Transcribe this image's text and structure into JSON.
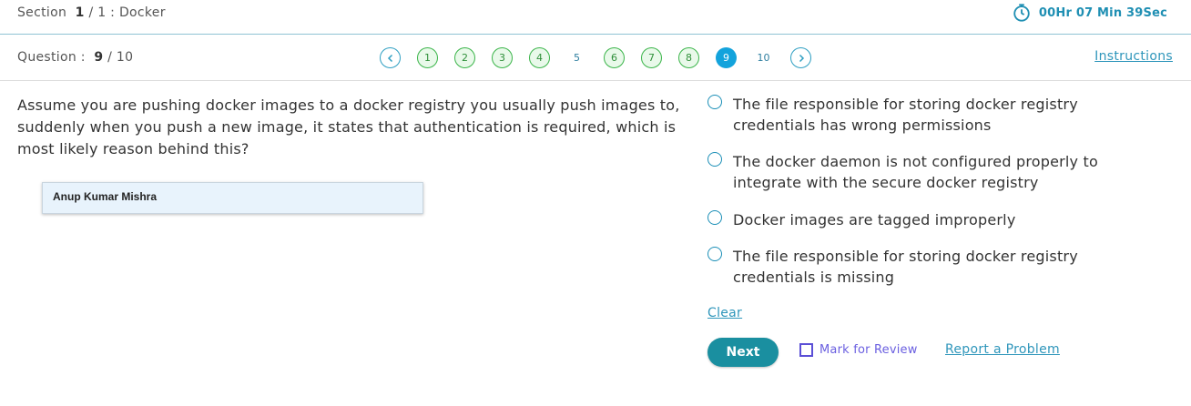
{
  "header": {
    "section_prefix": "Section",
    "section_index": "1",
    "section_total": "/ 1 : Docker",
    "timer": "00Hr 07 Min 39Sec"
  },
  "question_bar": {
    "label": "Question :",
    "current": "9",
    "total": "/ 10",
    "pages": [
      {
        "label": "1",
        "state": "answered"
      },
      {
        "label": "2",
        "state": "answered"
      },
      {
        "label": "3",
        "state": "answered"
      },
      {
        "label": "4",
        "state": "answered"
      },
      {
        "label": "5",
        "state": "unanswered"
      },
      {
        "label": "6",
        "state": "answered"
      },
      {
        "label": "7",
        "state": "answered"
      },
      {
        "label": "8",
        "state": "answered"
      },
      {
        "label": "9",
        "state": "current"
      },
      {
        "label": "10",
        "state": "unanswered"
      }
    ],
    "instructions_label": "Instructions"
  },
  "question": {
    "text": "Assume you are pushing docker images to a docker registry you usually push images to, suddenly when you push a new image, it states that authentication is required, which is most likely reason behind this?",
    "watermark": "Anup Kumar Mishra"
  },
  "options": [
    {
      "text": "The file responsible for storing docker registry credentials has wrong permissions"
    },
    {
      "text": "The docker daemon is not configured properly to integrate with the secure docker registry"
    },
    {
      "text": "Docker images are tagged improperly"
    },
    {
      "text": "The file responsible for storing docker registry credentials is missing"
    }
  ],
  "actions": {
    "clear_label": "Clear",
    "next_label": "Next",
    "review_label": "Mark for Review",
    "report_label": "Report a Problem"
  },
  "icons": {
    "timer": "stopwatch-icon",
    "prev": "chevron-left-icon",
    "next": "chevron-right-icon"
  },
  "colors": {
    "accent": "#1f8fb3",
    "answered": "#3bb54a",
    "current": "#13a3dc",
    "next_button": "#1a8fa0",
    "review": "#5b4fd6"
  }
}
